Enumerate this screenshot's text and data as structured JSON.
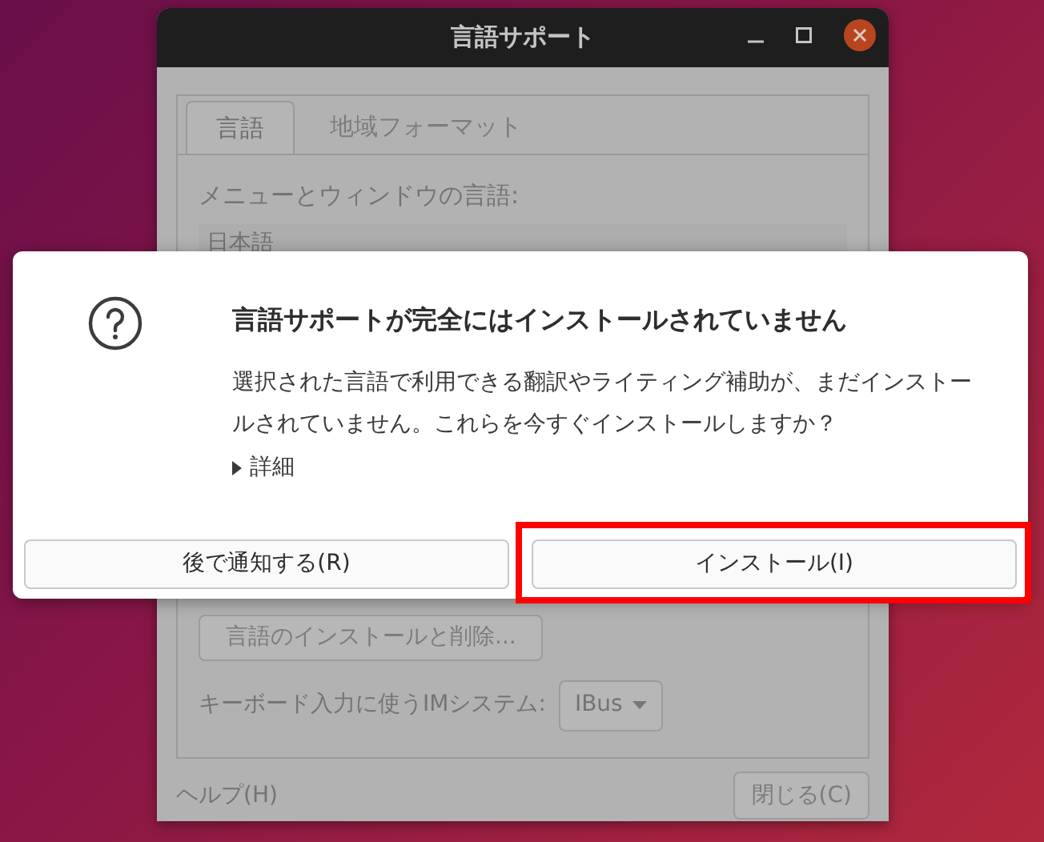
{
  "window": {
    "title": "言語サポート"
  },
  "tabs": [
    {
      "label": "言語",
      "selected": true
    },
    {
      "label": "地域フォーマット",
      "selected": false
    }
  ],
  "language_section": {
    "label": "メニューとウィンドウの言語:",
    "languages": [
      "日本語"
    ]
  },
  "install_remove_button": "言語のインストールと削除...",
  "im_system": {
    "label": "キーボード入力に使うIMシステム:",
    "value": "IBus"
  },
  "footer": {
    "help": "ヘルプ(H)",
    "close": "閉じる(C)"
  },
  "dialog": {
    "title": "言語サポートが完全にはインストールされていません",
    "message": "選択された言語で利用できる翻訳やライティング補助が、まだインストールされていません。これらを今すぐインストールしますか？",
    "details": {
      "label": "詳細",
      "expanded": false
    },
    "buttons": [
      {
        "label": "後で通知する(R)",
        "highlighted": false
      },
      {
        "label": "インストール(I)",
        "highlighted": true
      }
    ]
  }
}
